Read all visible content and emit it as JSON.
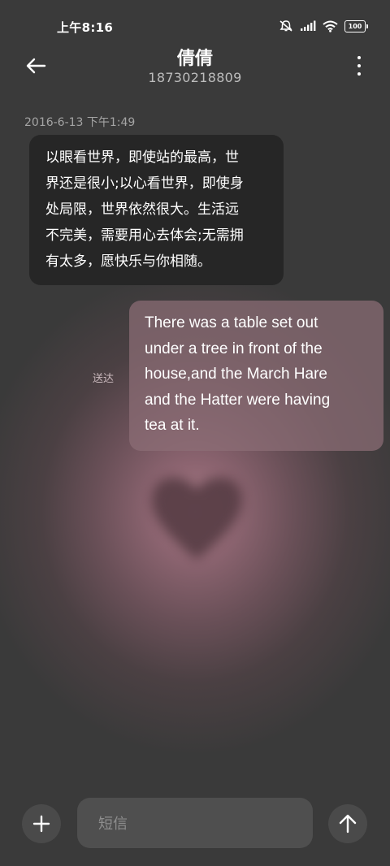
{
  "status_bar": {
    "time": "上午8:16",
    "battery": "100",
    "icons": [
      "mute-icon",
      "signal-icon",
      "wifi-icon",
      "battery-icon"
    ]
  },
  "header": {
    "contact_name": "倩倩",
    "contact_number": "18730218809",
    "icons": [
      "back-arrow-icon",
      "more-vertical-icon"
    ]
  },
  "conversation": {
    "timestamp": "2016-6-13 下午1:49",
    "messages": [
      {
        "direction": "incoming",
        "text": "以眼看世界，即使站的最高，世\n界还是很小;以心看世界，即使身\n处局限，世界依然很大。生活远\n不完美，需要用心去体会;无需拥\n有太多，愿快乐与你相随。"
      },
      {
        "direction": "outgoing",
        "text": "There was a table set out\nunder a tree in front of the\nhouse,and the March Hare\nand the Hatter were having\ntea at it.",
        "status": "送达"
      }
    ]
  },
  "composer": {
    "placeholder": "短信",
    "icons": [
      "plus-icon",
      "send-arrow-icon"
    ]
  },
  "colors": {
    "background": "#383838",
    "glow": "#a77b86",
    "incoming_bubble": "#262626",
    "outgoing_bubble": "#8c6e76"
  }
}
